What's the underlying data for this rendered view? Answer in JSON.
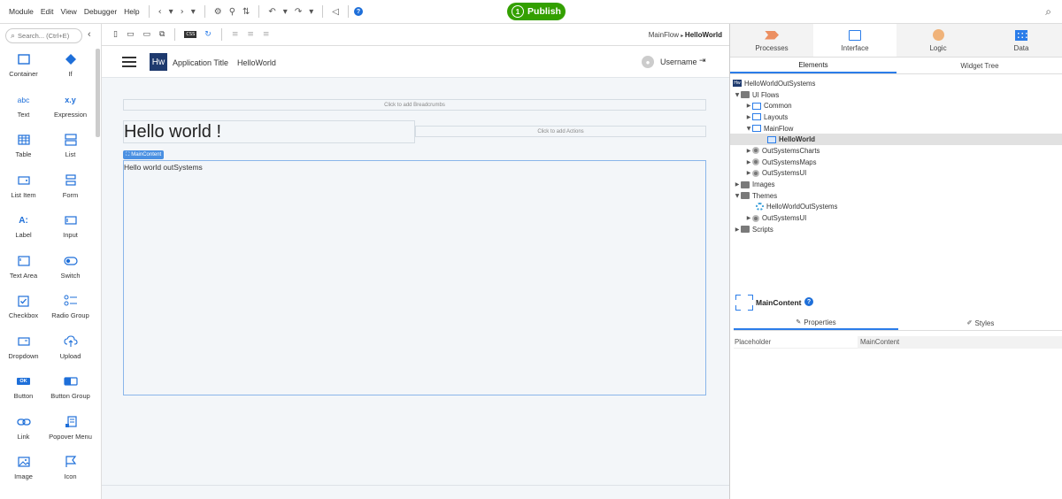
{
  "menubar": {
    "items": [
      "Module",
      "Edit",
      "View",
      "Debugger",
      "Help"
    ],
    "publish_number": "1",
    "publish_label": "Publish"
  },
  "toolbox": {
    "search_placeholder": "Search... (Ctrl+E)",
    "widgets": [
      {
        "label": "Container",
        "icon": "container-icon"
      },
      {
        "label": "If",
        "icon": "if-icon"
      },
      {
        "label": "Text",
        "icon": "text-icon",
        "glyph": "abc"
      },
      {
        "label": "Expression",
        "icon": "expression-icon",
        "glyph": "x.y"
      },
      {
        "label": "Table",
        "icon": "table-icon"
      },
      {
        "label": "List",
        "icon": "list-icon"
      },
      {
        "label": "List Item",
        "icon": "list-item-icon"
      },
      {
        "label": "Form",
        "icon": "form-icon"
      },
      {
        "label": "Label",
        "icon": "label-icon",
        "glyph": "A:"
      },
      {
        "label": "Input",
        "icon": "input-icon"
      },
      {
        "label": "Text Area",
        "icon": "text-area-icon"
      },
      {
        "label": "Switch",
        "icon": "switch-icon"
      },
      {
        "label": "Checkbox",
        "icon": "checkbox-icon"
      },
      {
        "label": "Radio Group",
        "icon": "radio-group-icon"
      },
      {
        "label": "Dropdown",
        "icon": "dropdown-icon"
      },
      {
        "label": "Upload",
        "icon": "upload-icon"
      },
      {
        "label": "Button",
        "icon": "button-icon",
        "glyph": "OK"
      },
      {
        "label": "Button Group",
        "icon": "button-group-icon"
      },
      {
        "label": "Link",
        "icon": "link-icon"
      },
      {
        "label": "Popover Menu",
        "icon": "popover-menu-icon"
      },
      {
        "label": "Image",
        "icon": "image-icon"
      },
      {
        "label": "Icon",
        "icon": "flag-icon"
      }
    ]
  },
  "canvas_toolbar": {
    "breadcrumb_flow": "MainFlow",
    "breadcrumb_screen": "HelloWorld"
  },
  "app": {
    "logo_text": "Hw",
    "title": "Application Title",
    "page": "HelloWorld",
    "username": "Username",
    "breadcrumbs_placeholder": "Click to add Breadcrumbs",
    "hello_title": "Hello world !",
    "actions_placeholder": "Click to add Actions",
    "main_content_badge": "MainContent",
    "main_text": "Hello world outSystems"
  },
  "right_panel": {
    "tabs": [
      {
        "label": "Processes",
        "icon": "processes-icon"
      },
      {
        "label": "Interface",
        "icon": "interface-icon"
      },
      {
        "label": "Logic",
        "icon": "logic-icon"
      },
      {
        "label": "Data",
        "icon": "data-icon"
      }
    ],
    "active_tab": 1,
    "subtabs": [
      "Elements",
      "Widget Tree"
    ],
    "tree": [
      {
        "label": "HelloWorldOutSystems",
        "level": 0,
        "caret": "",
        "icon": "hw-icon"
      },
      {
        "label": "UI Flows",
        "level": 0,
        "caret": "▼",
        "icon": "folder-icon"
      },
      {
        "label": "Common",
        "level": 1,
        "caret": "▶",
        "icon": "flow-icon"
      },
      {
        "label": "Layouts",
        "level": 1,
        "caret": "▶",
        "icon": "flow-icon"
      },
      {
        "label": "MainFlow",
        "level": 1,
        "caret": "▼",
        "icon": "flow-icon"
      },
      {
        "label": "HelloWorld",
        "level": 2,
        "caret": "",
        "icon": "screen-icon",
        "selected": true
      },
      {
        "label": "OutSystemsCharts",
        "level": 1,
        "caret": "▶",
        "icon": "dependency-icon"
      },
      {
        "label": "OutSystemsMaps",
        "level": 1,
        "caret": "▶",
        "icon": "dependency-icon"
      },
      {
        "label": "OutSystemsUI",
        "level": 1,
        "caret": "▶",
        "icon": "dependency-icon"
      },
      {
        "label": "Images",
        "level": 0,
        "caret": "▶",
        "icon": "folder-icon"
      },
      {
        "label": "Themes",
        "level": 0,
        "caret": "▼",
        "icon": "folder-icon"
      },
      {
        "label": "HelloWorldOutSystems",
        "level": 1,
        "caret": "",
        "icon": "theme-icon"
      },
      {
        "label": "OutSystemsUI",
        "level": 1,
        "caret": "▶",
        "icon": "dependency-icon"
      },
      {
        "label": "Scripts",
        "level": 0,
        "caret": "▶",
        "icon": "folder-icon"
      }
    ],
    "properties": {
      "element_name": "MainContent",
      "tabs": [
        "Properties",
        "Styles"
      ],
      "placeholder_label": "Placeholder",
      "placeholder_value": "MainContent"
    }
  }
}
